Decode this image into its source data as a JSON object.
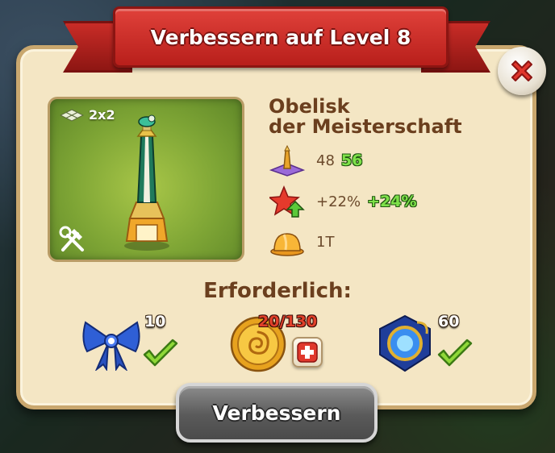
{
  "dialog": {
    "title": "Verbessern auf Level 8",
    "building_name_line1": "Obelisk",
    "building_name_line2": "der Meisterschaft",
    "size": "2x2",
    "stats": {
      "population_current": "48",
      "population_new": "56",
      "bonus_current": "+22%",
      "bonus_new": "+24%",
      "build_time": "1T"
    },
    "required_title": "Erforderlich:",
    "requirements": [
      {
        "icon": "blue-bow-icon",
        "count": "10",
        "fulfilled": true
      },
      {
        "icon": "gold-coin-icon",
        "count": "20/130",
        "fulfilled": false
      },
      {
        "icon": "blue-gem-amulet-icon",
        "count": "60",
        "fulfilled": true
      }
    ],
    "upgrade_button": "Verbessern"
  },
  "colors": {
    "ribbon": "#d02e29",
    "panel": "#f4e6c4",
    "title_text": "#6b3f1e",
    "new_value": "#7ee14a",
    "short_count": "#e0402a",
    "button_gray": "#5a5a5a"
  }
}
